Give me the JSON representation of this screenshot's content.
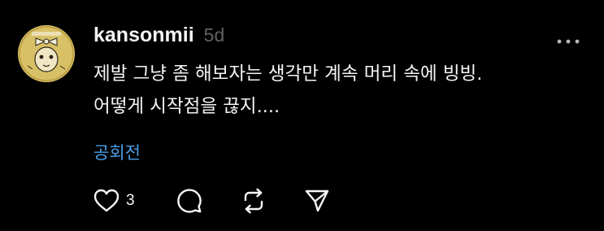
{
  "post": {
    "username": "kansonmii",
    "time_ago": "5d",
    "body_lines": [
      "제발 그냥 좀 해보자는 생각만 계속 머리 속에 빙빙.",
      "어떻게 시작점을 끊지...."
    ],
    "translate_label": "공회전",
    "like_count": "3",
    "icons": {
      "more": "more-horizontal-icon",
      "like": "heart-icon",
      "reply": "comment-bubble-icon",
      "repost": "repost-arrows-icon",
      "share": "send-paper-plane-icon"
    },
    "colors": {
      "background": "#000000",
      "text": "#f3f5f7",
      "secondary": "#616161",
      "link": "#4a9fe8",
      "avatar": "#d8c067"
    }
  }
}
